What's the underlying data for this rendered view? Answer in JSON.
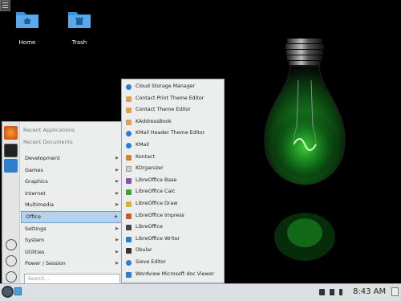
{
  "desktop": {
    "icons": [
      {
        "label": "Home"
      },
      {
        "label": "Trash"
      }
    ]
  },
  "launcher": {
    "recent_applications": "Recent Applications",
    "recent_documents": "Recent Documents",
    "categories": [
      {
        "label": "Development"
      },
      {
        "label": "Games"
      },
      {
        "label": "Graphics"
      },
      {
        "label": "Internet"
      },
      {
        "label": "Multimedia"
      },
      {
        "label": "Office",
        "active": true
      },
      {
        "label": "Settings"
      },
      {
        "label": "System"
      },
      {
        "label": "Utilities"
      },
      {
        "label": "Power / Session"
      }
    ],
    "search_placeholder": "Search...",
    "accent": "#b7d2ea"
  },
  "submenu": {
    "items": [
      {
        "label": "Cloud Storage Manager",
        "icon": "cloud-icon",
        "color": "#2a7fd0"
      },
      {
        "label": "Contact Print Theme Editor",
        "icon": "theme-editor-icon",
        "color": "#e0a050"
      },
      {
        "label": "Contact Theme Editor",
        "icon": "theme-editor-icon",
        "color": "#e0a050"
      },
      {
        "label": "KAddressBook",
        "icon": "address-book-icon",
        "color": "#e0a050"
      },
      {
        "label": "KMail Header Theme Editor",
        "icon": "kmail-icon",
        "color": "#2a7fd0"
      },
      {
        "label": "KMail",
        "icon": "kmail-icon",
        "color": "#2a7fd0"
      },
      {
        "label": "Kontact",
        "icon": "kontact-icon",
        "color": "#d08030"
      },
      {
        "label": "KOrganizer",
        "icon": "calendar-icon",
        "color": "#cfcfcf"
      },
      {
        "label": "LibreOffice Base",
        "icon": "lo-base-icon",
        "color": "#8a4fb0"
      },
      {
        "label": "LibreOffice Calc",
        "icon": "lo-calc-icon",
        "color": "#3aa23a"
      },
      {
        "label": "LibreOffice Draw",
        "icon": "lo-draw-icon",
        "color": "#e0b030"
      },
      {
        "label": "LibreOffice Impress",
        "icon": "lo-impress-icon",
        "color": "#d0552a"
      },
      {
        "label": "LibreOffice",
        "icon": "libreoffice-icon",
        "color": "#444"
      },
      {
        "label": "LibreOffice Writer",
        "icon": "lo-writer-icon",
        "color": "#2a7fd0"
      },
      {
        "label": "Okular",
        "icon": "okular-icon",
        "color": "#333"
      },
      {
        "label": "Sieve Editor",
        "icon": "sieve-icon",
        "color": "#2a7fd0"
      },
      {
        "label": "Wordview Microsoft doc Viewer",
        "icon": "wordview-icon",
        "color": "#2a7fd0"
      }
    ]
  },
  "taskbar": {
    "clock": "8:43 AM"
  }
}
